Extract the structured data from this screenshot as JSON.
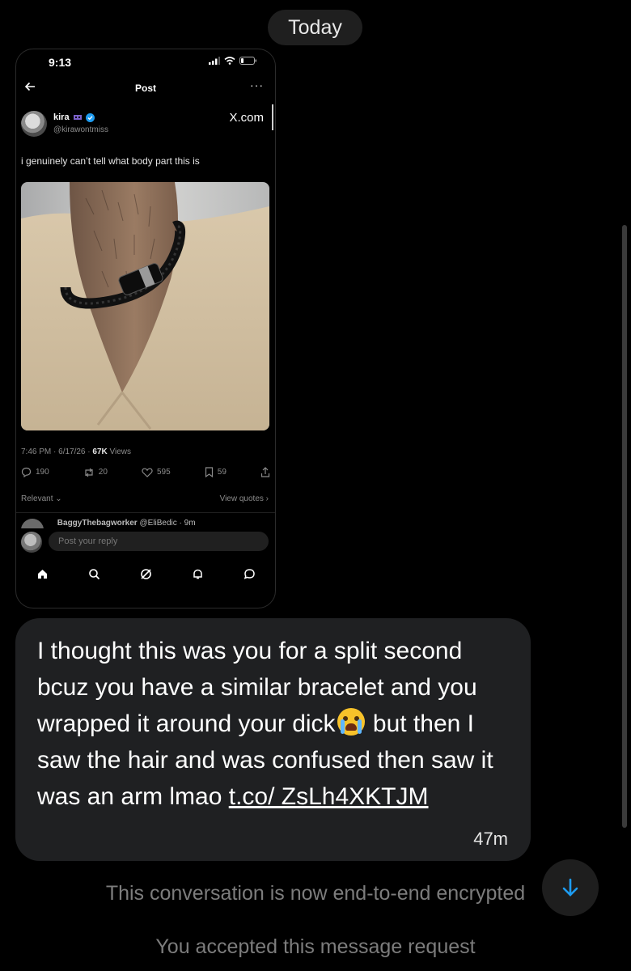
{
  "conversation": {
    "date_separator": "Today",
    "shared_screenshot": {
      "status_time": "9:13",
      "nav_title": "Post",
      "author_name": "kira",
      "author_handle": "@kirawontmiss",
      "source_label": "X.com",
      "post_text": "i genuinely can’t tell what body part this is",
      "timestamp": "7:46 PM · 6/17/26 ·",
      "views_count": "67K",
      "views_label": "Views",
      "replies_count": "190",
      "reposts_count": "20",
      "likes_count": "595",
      "bookmarks_count": "59",
      "sort_label": "Relevant",
      "view_quotes_label": "View quotes",
      "reply_preview": "BaggyThebagworker",
      "reply_preview_handle": "@EliBedic · 9m",
      "reply_placeholder": "Post your reply"
    },
    "message": {
      "text_before_emoji": "I thought this was you for a split second bcuz you have a similar bracelet and you wrapped it around your dick",
      "emoji": "loudly-crying-face",
      "text_after_emoji": " but then I saw the hair and was confused then saw it was an arm lmao ",
      "link": "t.co/ ZsLh4XKTJM",
      "time": "47m"
    },
    "system_messages": {
      "encrypted": "This conversation is now end-to-end encrypted",
      "accepted": "You accepted this message request"
    },
    "colors": {
      "background": "#000000",
      "bubble": "#1f2022",
      "system_text": "#7c7c7c",
      "accent": "#1d9bf0"
    }
  }
}
